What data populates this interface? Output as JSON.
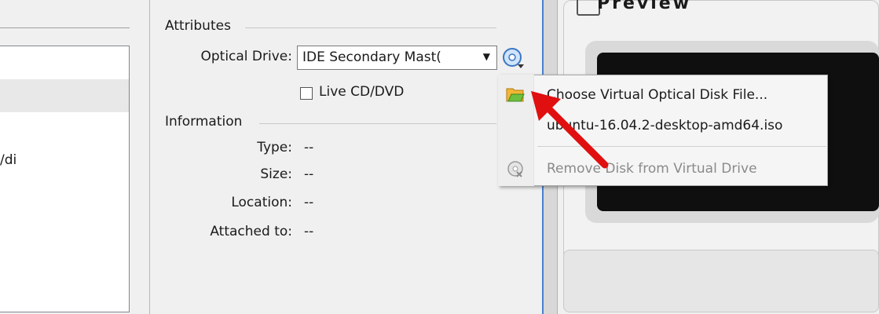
{
  "left": {
    "partial_text": "/di"
  },
  "attributes": {
    "title": "Attributes",
    "optical_drive_label": "Optical Drive:",
    "optical_drive_value": "IDE Secondary Mast(",
    "live_cd_label": "Live CD/DVD"
  },
  "information": {
    "title": "Information",
    "rows": [
      {
        "label": "Type:",
        "value": "--"
      },
      {
        "label": "Size:",
        "value": "--"
      },
      {
        "label": "Location:",
        "value": "--"
      },
      {
        "label": "Attached to:",
        "value": "--"
      }
    ]
  },
  "preview": {
    "title": "Preview"
  },
  "menu": {
    "items": [
      {
        "label": "Choose Virtual Optical Disk File...",
        "icon": "folder-icon",
        "enabled": true
      },
      {
        "label": "ubuntu-16.04.2-desktop-amd64.iso",
        "icon": "",
        "enabled": true
      },
      {
        "label": "Remove Disk from Virtual Drive",
        "icon": "remove-disk-icon",
        "enabled": false
      }
    ]
  },
  "colors": {
    "annotation_arrow": "#e01010",
    "selection_accent": "#4a7fd0"
  }
}
